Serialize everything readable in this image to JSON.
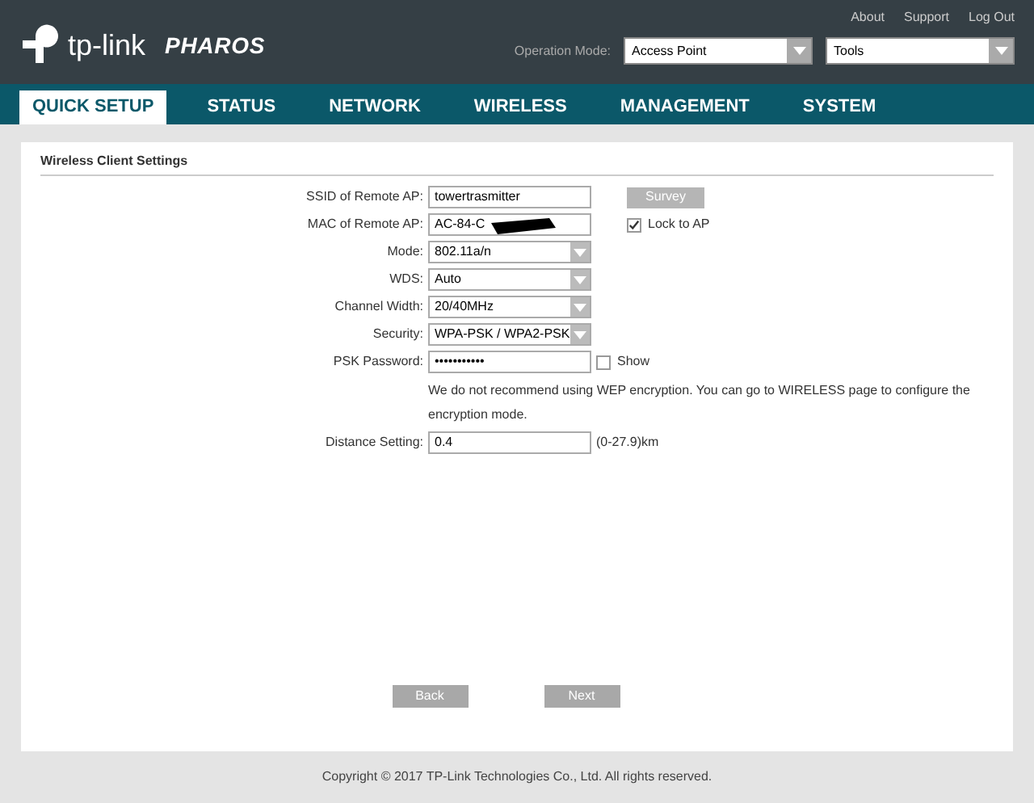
{
  "header": {
    "brand": "tp-link",
    "product": "PHAROS",
    "links": [
      "About",
      "Support",
      "Log Out"
    ],
    "operation_mode": {
      "label": "Operation Mode:",
      "value": "Access Point"
    },
    "tools": {
      "value": "Tools"
    }
  },
  "nav": [
    {
      "label": "QUICK SETUP",
      "selected": true
    },
    {
      "label": "STATUS",
      "selected": false
    },
    {
      "label": "NETWORK",
      "selected": false
    },
    {
      "label": "WIRELESS",
      "selected": false
    },
    {
      "label": "MANAGEMENT",
      "selected": false
    },
    {
      "label": "SYSTEM",
      "selected": false
    }
  ],
  "section_title": "Wireless Client Settings",
  "fields": [
    {
      "kind": "text",
      "label": "SSID of Remote AP:",
      "value": "towertrasmitter",
      "button": "Survey"
    },
    {
      "kind": "redacted",
      "label": "MAC of Remote AP:",
      "value": "AC-84-C",
      "checkbox": {
        "label": "Lock to AP",
        "checked": true
      }
    },
    {
      "kind": "select",
      "label": "Mode:",
      "value": "802.11a/n"
    },
    {
      "kind": "select",
      "label": "WDS:",
      "value": "Auto"
    },
    {
      "kind": "select",
      "label": "Channel Width:",
      "value": "20/40MHz"
    },
    {
      "kind": "select",
      "label": "Security:",
      "value": "WPA-PSK / WPA2-PSK"
    },
    {
      "kind": "password",
      "label": "PSK Password:",
      "value": "•••••••••••",
      "checkbox": {
        "label": "Show",
        "checked": false
      }
    },
    {
      "kind": "note",
      "value": "We do not recommend using WEP encryption. You can go to WIRELESS page to configure the encryption mode."
    },
    {
      "kind": "text",
      "label": "Distance Setting:",
      "value": "0.4",
      "suffix": "(0-27.9)km"
    }
  ],
  "buttons": [
    "Back",
    "Next"
  ],
  "footer": "Copyright © 2017 TP-Link Technologies Co., Ltd. All rights reserved."
}
